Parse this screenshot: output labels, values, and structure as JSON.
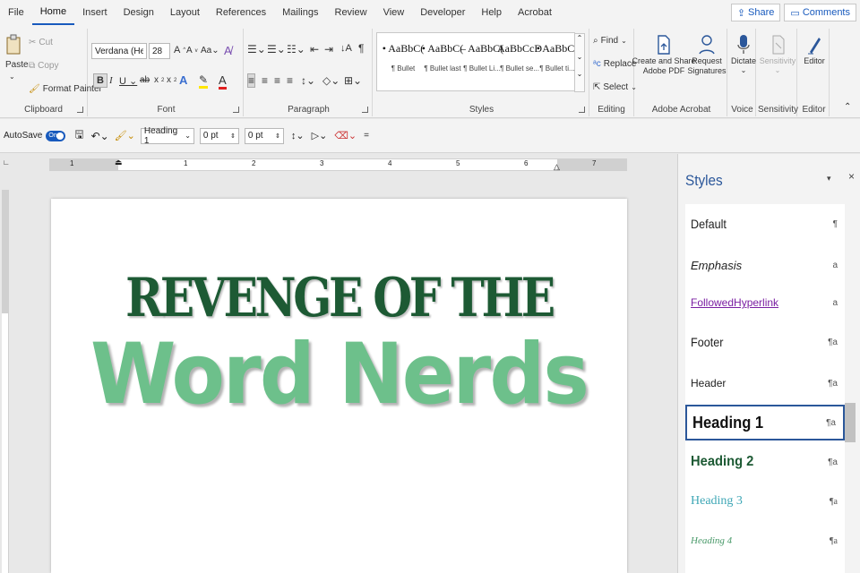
{
  "menu": {
    "tabs": [
      "File",
      "Home",
      "Insert",
      "Design",
      "Layout",
      "References",
      "Mailings",
      "Review",
      "View",
      "Developer",
      "Help",
      "Acrobat"
    ],
    "active": "Home",
    "share_label": "Share",
    "comments_label": "Comments"
  },
  "ribbon": {
    "clipboard": {
      "label": "Clipboard",
      "paste": "Paste",
      "cut": "Cut",
      "copy": "Copy",
      "format_painter": "Format Painter"
    },
    "font": {
      "label": "Font",
      "font_name": "Verdana (Headir",
      "font_size": "28"
    },
    "paragraph": {
      "label": "Paragraph"
    },
    "styles": {
      "label": "Styles",
      "items": [
        {
          "preview": "• AaBbC(",
          "name": "¶ Bullet"
        },
        {
          "preview": "• AaBbC(",
          "name": "¶ Bullet last"
        },
        {
          "preview": "– AaBbC(",
          "name": "¶ Bullet Li..."
        },
        {
          "preview": "AaBbCcD",
          "name": "¶ Bullet se..."
        },
        {
          "preview": "• AaBbC(",
          "name": "¶ Bullet ti..."
        }
      ]
    },
    "editing": {
      "label": "Editing",
      "find": "Find",
      "replace": "Replace",
      "select": "Select"
    },
    "acrobat": {
      "label": "Adobe Acrobat",
      "create_share": "Create and Share",
      "create_share_2": "Adobe PDF",
      "request": "Request",
      "request_2": "Signatures"
    },
    "voice": {
      "label": "Voice",
      "dictate": "Dictate"
    },
    "sensitivity": {
      "label": "Sensitivity",
      "button": "Sensitivity"
    },
    "editor": {
      "label": "Editor",
      "button": "Editor"
    }
  },
  "qat": {
    "autosave": "AutoSave",
    "toggle_state": "On",
    "style_box": "Heading 1",
    "spacing_before": "0 pt",
    "spacing_after": "0 pt"
  },
  "ruler": {
    "numbers": [
      "1",
      "1",
      "2",
      "3",
      "4",
      "5",
      "6",
      "7"
    ]
  },
  "document": {
    "line1": "REVENGE OF THE",
    "line2": "Word Nerds"
  },
  "styles_pane": {
    "title": "Styles",
    "items": [
      {
        "name": "Default",
        "mark": "¶"
      },
      {
        "name": "Emphasis",
        "mark": "a"
      },
      {
        "name": "FollowedHyperlink",
        "mark": "a"
      },
      {
        "name": "Footer",
        "mark": "¶a"
      },
      {
        "name": "Header",
        "mark": "¶a"
      },
      {
        "name": "Heading 1",
        "mark": "¶a"
      },
      {
        "name": "Heading 2",
        "mark": "¶a"
      },
      {
        "name": "Heading 3",
        "mark": "¶a"
      },
      {
        "name": "Heading 4",
        "mark": "¶a"
      }
    ],
    "selected": "Heading 1"
  },
  "colors": {
    "accent": "#185abd",
    "title_dark": "#1d5a34",
    "title_light": "#6dc08b",
    "heading3": "#3fa7b6",
    "heading4": "#4a9a6a",
    "hyperlink": "#7a1fa2"
  }
}
